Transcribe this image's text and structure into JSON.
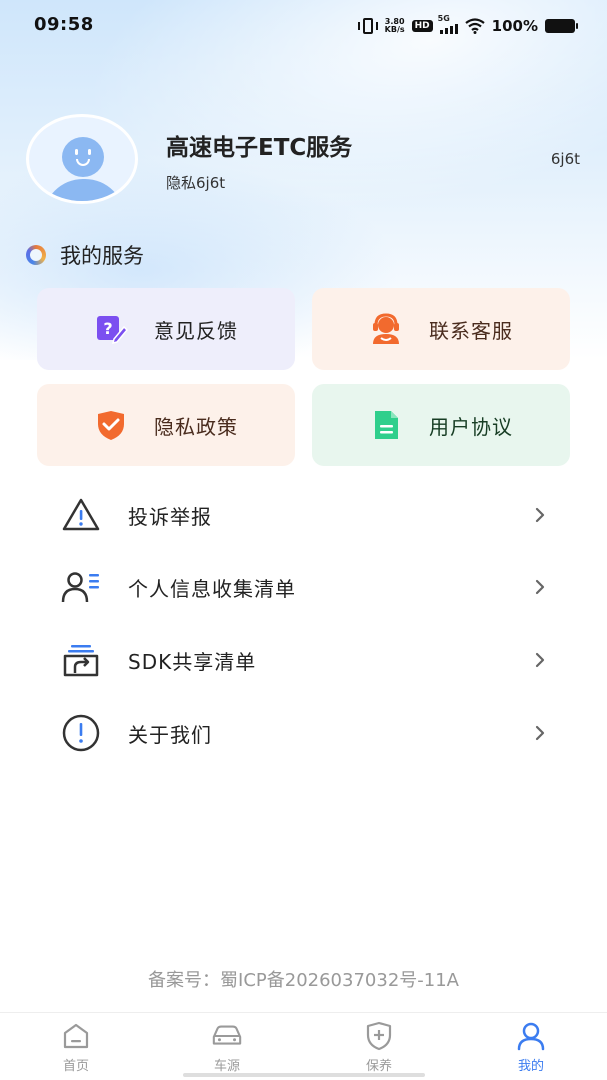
{
  "status_bar": {
    "time": "09:58",
    "net_speed_value": "3.80",
    "net_speed_unit": "KB/s",
    "hd": "HD",
    "network": "5G",
    "battery": "100%"
  },
  "profile": {
    "name": "高速电子ETC服务",
    "subtitle": "隐私6j6t",
    "right_text": "6j6t"
  },
  "services": {
    "title": "我的服务",
    "cards": [
      {
        "label": "意见反馈",
        "icon": "feedback-icon",
        "color": "#7b4ff0"
      },
      {
        "label": "联系客服",
        "icon": "customer-service-icon",
        "color": "#f26a2e"
      },
      {
        "label": "隐私政策",
        "icon": "shield-icon",
        "color": "#f26a2e"
      },
      {
        "label": "用户协议",
        "icon": "document-icon",
        "color": "#2fcf8c"
      }
    ]
  },
  "menu": [
    {
      "label": "投诉举报",
      "icon": "warning-icon"
    },
    {
      "label": "个人信息收集清单",
      "icon": "user-list-icon"
    },
    {
      "label": "SDK共享清单",
      "icon": "share-icon"
    },
    {
      "label": "关于我们",
      "icon": "info-icon"
    }
  ],
  "footer": {
    "icp": "备案号：蜀ICP备2026037032号-11A"
  },
  "tabbar": {
    "active_color": "#3b7cf0",
    "items": [
      {
        "label": "首页",
        "icon": "home-icon"
      },
      {
        "label": "车源",
        "icon": "car-icon"
      },
      {
        "label": "保养",
        "icon": "shield-plus-icon"
      },
      {
        "label": "我的",
        "icon": "user-icon"
      }
    ]
  }
}
